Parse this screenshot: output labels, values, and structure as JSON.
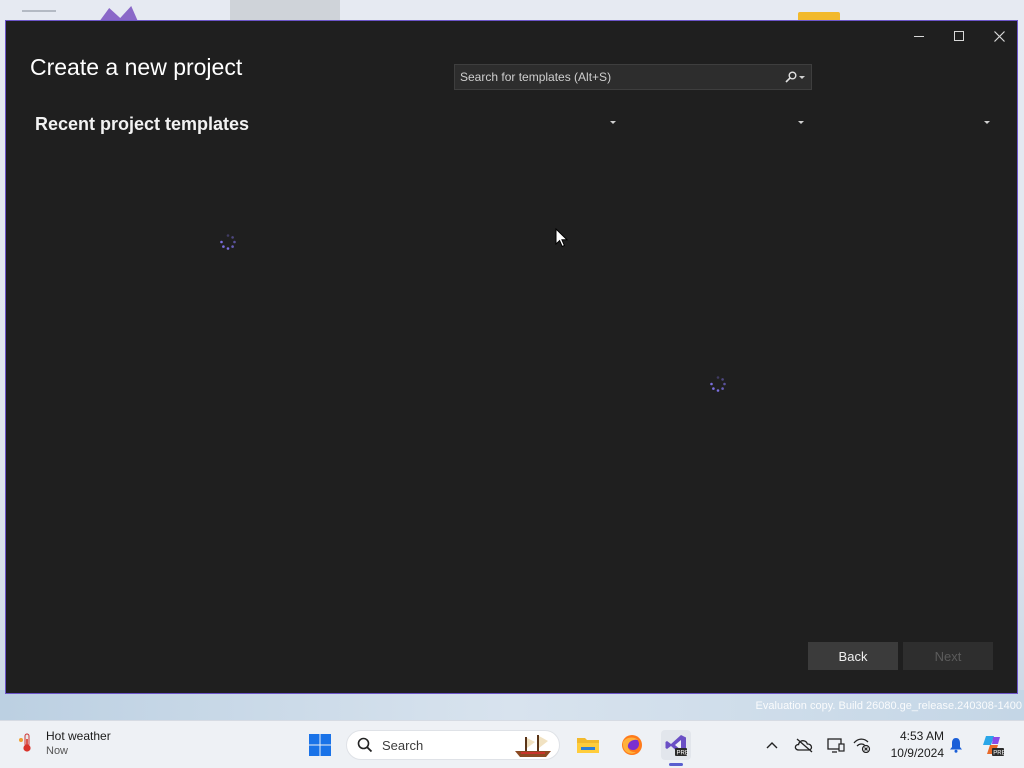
{
  "dialog": {
    "title": "Create a new project",
    "recent_heading": "Recent project templates",
    "search": {
      "placeholder": "Search for templates (Alt+S)",
      "value": ""
    },
    "filters": [
      {
        "name": "language",
        "value": ""
      },
      {
        "name": "platform",
        "value": ""
      },
      {
        "name": "project-type",
        "value": ""
      }
    ],
    "buttons": {
      "back": "Back",
      "next": "Next"
    },
    "window_controls": [
      "minimize-icon",
      "maximize-icon",
      "close-icon"
    ]
  },
  "watermark": "Evaluation copy. Build 26080.ge_release.240308-1400",
  "taskbar": {
    "weather": {
      "title": "Hot weather",
      "subtitle": "Now"
    },
    "search_label": "Search",
    "clock": {
      "time": "4:53 AM",
      "date": "10/9/2024"
    },
    "apps": [
      "file-explorer-icon",
      "firefox-icon",
      "visual-studio-preview-icon"
    ]
  },
  "colors": {
    "accent": "#6c55c9",
    "dialog_bg": "#1f1f1f",
    "spinner": "#7b6fe0",
    "taskbar_bg": "#eef1f5"
  }
}
